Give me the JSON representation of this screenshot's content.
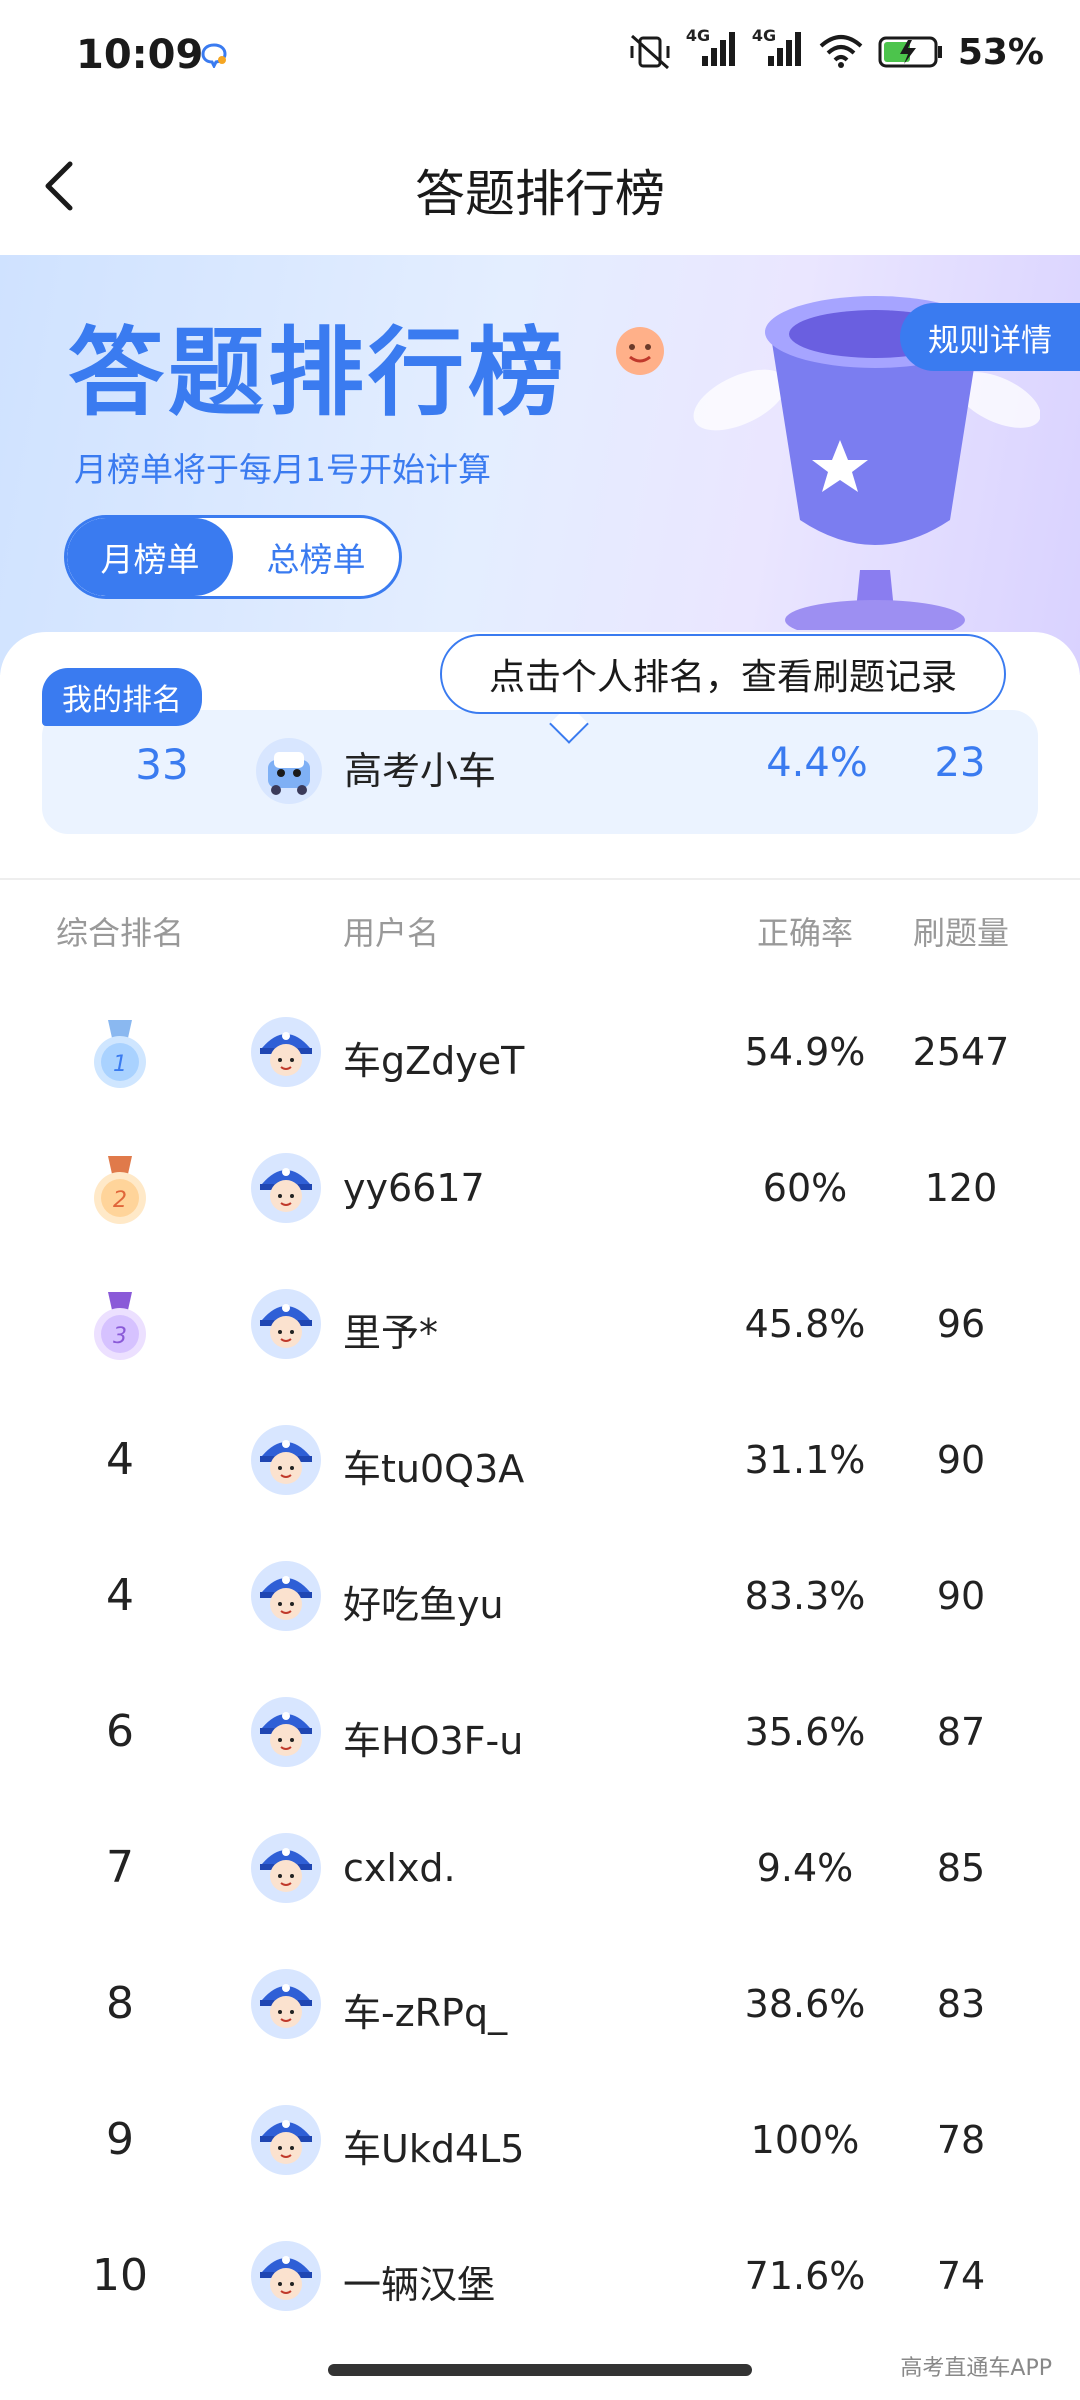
{
  "status": {
    "time": "10:09",
    "net1": "4G",
    "net2": "4G",
    "battery": "53%"
  },
  "header": {
    "title": "答题排行榜"
  },
  "hero": {
    "title": "答题排行榜",
    "subtitle": "月榜单将于每月1号开始计算",
    "tabs": [
      {
        "label": "月榜单",
        "active": true
      },
      {
        "label": "总榜单",
        "active": false
      }
    ],
    "rules_label": "规则详情"
  },
  "my_rank": {
    "badge": "我的排名",
    "rank": "33",
    "name": "高考小车",
    "rate": "4.4%",
    "count": "23",
    "tooltip": "点击个人排名，查看刷题记录"
  },
  "table": {
    "headers": {
      "rank": "综合排名",
      "user": "用户名",
      "rate": "正确率",
      "count": "刷题量"
    },
    "rows": [
      {
        "rank": "1",
        "name": "车gZdyeT",
        "rate": "54.9%",
        "count": "2547"
      },
      {
        "rank": "2",
        "name": "yy6617",
        "rate": "60%",
        "count": "120"
      },
      {
        "rank": "3",
        "name": "里予*",
        "rate": "45.8%",
        "count": "96"
      },
      {
        "rank": "4",
        "name": "车tu0Q3A",
        "rate": "31.1%",
        "count": "90"
      },
      {
        "rank": "4",
        "name": "好吃鱼yu",
        "rate": "83.3%",
        "count": "90"
      },
      {
        "rank": "6",
        "name": "车HO3F-u",
        "rate": "35.6%",
        "count": "87"
      },
      {
        "rank": "7",
        "name": "cxlxd.",
        "rate": "9.4%",
        "count": "85"
      },
      {
        "rank": "8",
        "name": "车-zRPq_",
        "rate": "38.6%",
        "count": "83"
      },
      {
        "rank": "9",
        "name": "车Ukd4L5",
        "rate": "100%",
        "count": "78"
      },
      {
        "rank": "10",
        "name": "一辆汉堡",
        "rate": "71.6%",
        "count": "74"
      }
    ]
  },
  "watermark": "高考直通车APP",
  "colors": {
    "accent": "#3a7bf0",
    "gold": "#f5a623",
    "silver": "#6ab0ee",
    "bronze": "#f08a4b",
    "purple": "#9a6ee8"
  }
}
